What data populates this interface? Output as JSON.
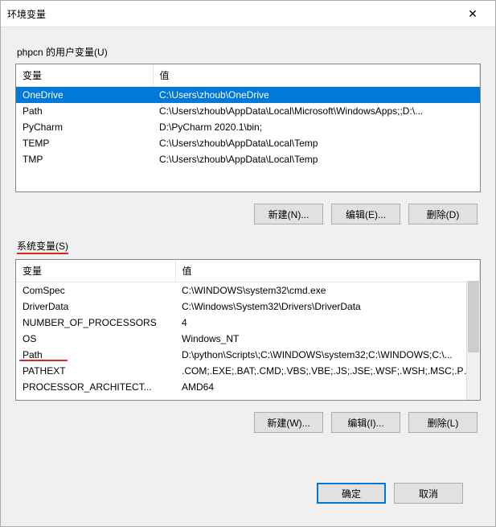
{
  "window": {
    "title": "环境变量"
  },
  "userSection": {
    "label": "phpcn 的用户变量(U)",
    "colVar": "变量",
    "colVal": "值",
    "rows": [
      {
        "var": "OneDrive",
        "val": "C:\\Users\\zhoub\\OneDrive"
      },
      {
        "var": "Path",
        "val": "C:\\Users\\zhoub\\AppData\\Local\\Microsoft\\WindowsApps;;D:\\..."
      },
      {
        "var": "PyCharm",
        "val": "D:\\PyCharm 2020.1\\bin;"
      },
      {
        "var": "TEMP",
        "val": "C:\\Users\\zhoub\\AppData\\Local\\Temp"
      },
      {
        "var": "TMP",
        "val": "C:\\Users\\zhoub\\AppData\\Local\\Temp"
      }
    ],
    "buttons": {
      "new": "新建(N)...",
      "edit": "编辑(E)...",
      "del": "删除(D)"
    }
  },
  "sysSection": {
    "label": "系统变量(S)",
    "colVar": "变量",
    "colVal": "值",
    "rows": [
      {
        "var": "ComSpec",
        "val": "C:\\WINDOWS\\system32\\cmd.exe"
      },
      {
        "var": "DriverData",
        "val": "C:\\Windows\\System32\\Drivers\\DriverData"
      },
      {
        "var": "NUMBER_OF_PROCESSORS",
        "val": "4"
      },
      {
        "var": "OS",
        "val": "Windows_NT"
      },
      {
        "var": "Path",
        "val": "D:\\python\\Scripts\\;C:\\WINDOWS\\system32;C:\\WINDOWS;C:\\..."
      },
      {
        "var": "PATHEXT",
        "val": ".COM;.EXE;.BAT;.CMD;.VBS;.VBE;.JS;.JSE;.WSF;.WSH;.MSC;.PY;.P..."
      },
      {
        "var": "PROCESSOR_ARCHITECT...",
        "val": "AMD64"
      }
    ],
    "buttons": {
      "new": "新建(W)...",
      "edit": "编辑(I)...",
      "del": "删除(L)"
    }
  },
  "footer": {
    "ok": "确定",
    "cancel": "取消"
  }
}
